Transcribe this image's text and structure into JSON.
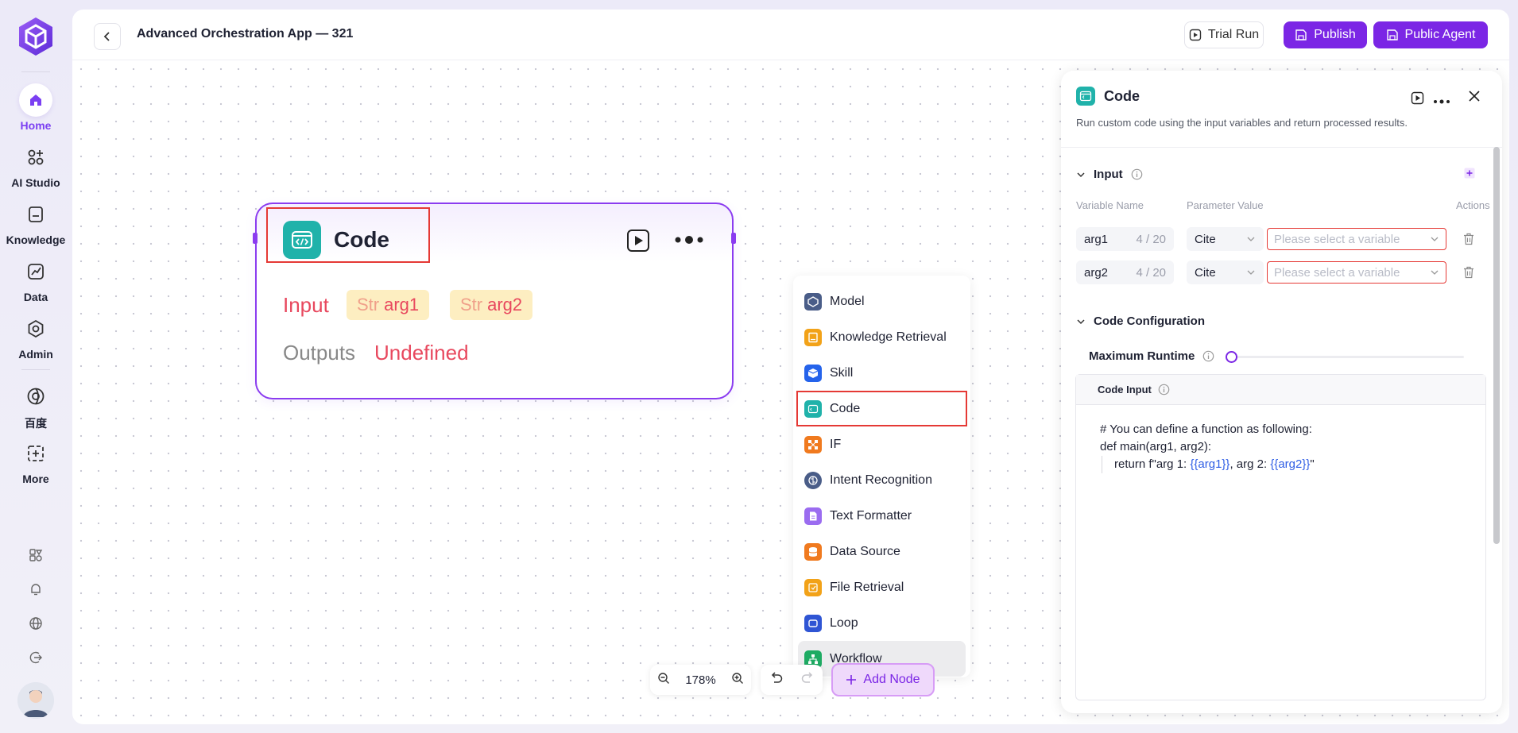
{
  "nav": {
    "items": [
      {
        "label": "Home"
      },
      {
        "label": "AI Studio"
      },
      {
        "label": "Knowledge"
      },
      {
        "label": "Data"
      },
      {
        "label": "Admin"
      },
      {
        "label": "百度"
      },
      {
        "label": "More"
      }
    ]
  },
  "header": {
    "title": "Advanced Orchestration App — 321",
    "trial_run": "Trial Run",
    "publish": "Publish",
    "public_agent": "Public Agent"
  },
  "node": {
    "title": "Code",
    "input_label": "Input",
    "inputs": [
      {
        "type": "Str",
        "name": "arg1"
      },
      {
        "type": "Str",
        "name": "arg2"
      }
    ],
    "outputs_label": "Outputs",
    "outputs_value": "Undefined"
  },
  "menu": {
    "items": [
      {
        "label": "Model",
        "color": "#4a5d88"
      },
      {
        "label": "Knowledge Retrieval",
        "color": "#f2a218"
      },
      {
        "label": "Skill",
        "color": "#2563eb"
      },
      {
        "label": "Code",
        "color": "#20b2aa"
      },
      {
        "label": "IF",
        "color": "#f07a1f"
      },
      {
        "label": "Intent Recognition",
        "color": "#4a5d88"
      },
      {
        "label": "Text Formatter",
        "color": "#9b6cf0"
      },
      {
        "label": "Data Source",
        "color": "#f07a1f"
      },
      {
        "label": "File Retrieval",
        "color": "#f2a218"
      },
      {
        "label": "Loop",
        "color": "#2f55d4"
      },
      {
        "label": "Workflow",
        "color": "#1eab63"
      }
    ]
  },
  "toolbar": {
    "zoom": "178%",
    "add_node": "Add Node"
  },
  "panel": {
    "title": "Code",
    "description": "Run custom code using the input variables and return processed results.",
    "input_section": "Input",
    "col_variable": "Variable Name",
    "col_parameter": "Parameter Value",
    "col_actions": "Actions",
    "rows": [
      {
        "name": "arg1",
        "count": "4 / 20",
        "cite": "Cite",
        "placeholder": "Please select a variable"
      },
      {
        "name": "arg2",
        "count": "4 / 20",
        "cite": "Cite",
        "placeholder": "Please select a variable"
      }
    ],
    "code_config": "Code Configuration",
    "max_runtime": "Maximum Runtime",
    "code_input": "Code Input",
    "code": {
      "line1": "# You can define a function as following:",
      "line2": "def main(arg1, arg2):",
      "line3_a": "return f\"arg 1: ",
      "line3_b": "{{arg1}}",
      "line3_c": ", arg 2: ",
      "line3_d": "{{arg2}}",
      "line3_e": "\""
    }
  }
}
